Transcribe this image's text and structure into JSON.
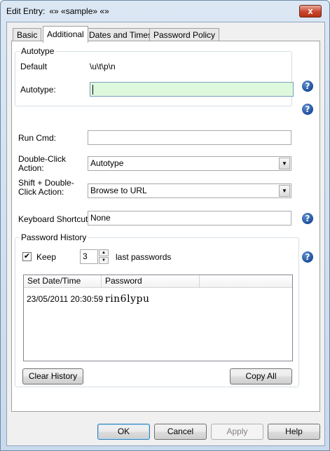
{
  "window": {
    "title": "Edit Entry:",
    "title_entry": "«» «sample» «»",
    "close_glyph": "x"
  },
  "tabs": [
    {
      "label": "Basic"
    },
    {
      "label": "Additional"
    },
    {
      "label": "Dates and Times"
    },
    {
      "label": "Password Policy"
    }
  ],
  "autotype_group": {
    "title": "Autotype",
    "default_label": "Default",
    "default_value": "\\u\\t\\p\\n",
    "autotype_label": "Autotype:",
    "autotype_value": ""
  },
  "run_cmd": {
    "label": "Run Cmd:",
    "value": ""
  },
  "double_click": {
    "label": "Double-Click Action:",
    "value": "Autotype"
  },
  "shift_double_click": {
    "label": "Shift + Double-Click Action:",
    "value": "Browse to URL"
  },
  "keyboard_shortcut": {
    "label": "Keyboard Shortcut",
    "value": "None"
  },
  "password_history": {
    "title": "Password History",
    "keep_label": "Keep",
    "keep_checked": true,
    "keep_count": "3",
    "suffix_label": "last passwords",
    "columns": [
      "Set Date/Time",
      "Password"
    ],
    "rows": [
      {
        "date": "23/05/2011 20:30:59",
        "password": "rin6lypu"
      }
    ],
    "clear_button": "Clear History",
    "copy_button": "Copy All"
  },
  "help_glyph": "?",
  "icons": {
    "help": "help-icon",
    "checkbox": "check-icon",
    "dropdown": "chevron-down-icon",
    "spin_up": "spin-up-icon",
    "spin_down": "spin-down-icon"
  },
  "colors": {
    "autotype_highlight": "#ddf8dd",
    "help_icon": "#1d4f9c",
    "close_button": "#c8452c"
  },
  "footer": {
    "ok": "OK",
    "cancel": "Cancel",
    "apply": "Apply",
    "help": "Help"
  }
}
